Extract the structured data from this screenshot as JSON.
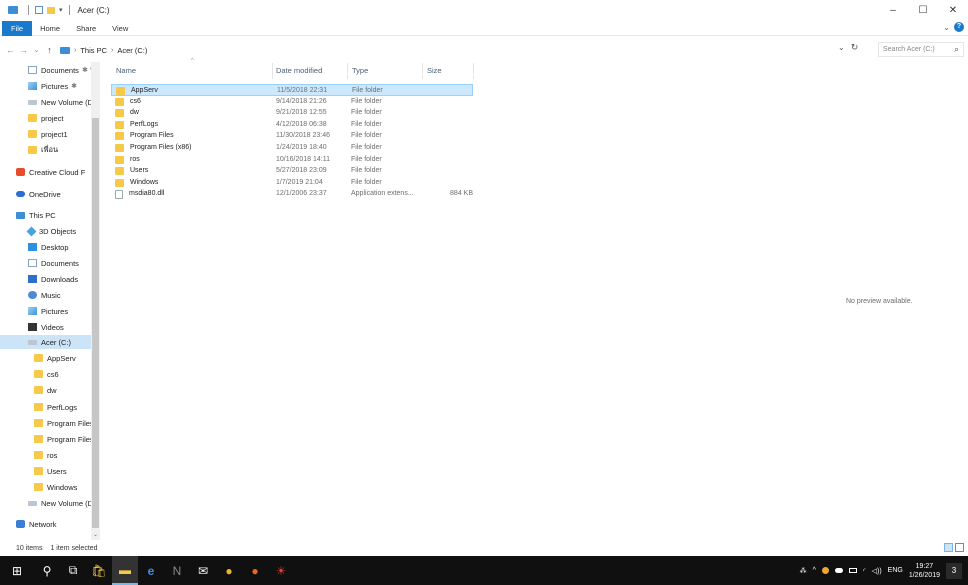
{
  "window": {
    "title": "Acer (C:)",
    "minimize": "–",
    "maximize": "☐",
    "close": "✕"
  },
  "ribbon": {
    "tabs": [
      "File",
      "Home",
      "Share",
      "View"
    ],
    "expand": "⌄",
    "help": "?"
  },
  "address": {
    "back": "←",
    "forward": "→",
    "recent": "⌄",
    "up": "↑",
    "crumbs": [
      "This PC",
      "Acer (C:)"
    ],
    "dropdown": "⌄",
    "refresh": "↻",
    "search_placeholder": "Search Acer (C:)",
    "search_icon": "⌕"
  },
  "nav": {
    "items": [
      {
        "label": "Documents",
        "icon": "doc",
        "pin": "✱ ^"
      },
      {
        "label": "Pictures",
        "icon": "pic",
        "pin": "✱"
      },
      {
        "label": "New Volume (D",
        "icon": "drive"
      },
      {
        "label": "project",
        "icon": "folder"
      },
      {
        "label": "project1",
        "icon": "folder"
      },
      {
        "label": "เพื่อน",
        "icon": "folder"
      },
      {
        "label": "Creative Cloud F",
        "icon": "cc"
      },
      {
        "label": "OneDrive",
        "icon": "cloud"
      },
      {
        "label": "This PC",
        "icon": "pc"
      },
      {
        "label": "3D Objects",
        "icon": "obj"
      },
      {
        "label": "Desktop",
        "icon": "desk"
      },
      {
        "label": "Documents",
        "icon": "doc"
      },
      {
        "label": "Downloads",
        "icon": "dl"
      },
      {
        "label": "Music",
        "icon": "music"
      },
      {
        "label": "Pictures",
        "icon": "pic"
      },
      {
        "label": "Videos",
        "icon": "video"
      },
      {
        "label": "Acer (C:)",
        "icon": "drive"
      },
      {
        "label": "AppServ",
        "icon": "folder"
      },
      {
        "label": "cs6",
        "icon": "folder"
      },
      {
        "label": "dw",
        "icon": "folder"
      },
      {
        "label": "PerfLogs",
        "icon": "folder"
      },
      {
        "label": "Program Files",
        "icon": "folder"
      },
      {
        "label": "Program Files",
        "icon": "folder"
      },
      {
        "label": "ros",
        "icon": "folder"
      },
      {
        "label": "Users",
        "icon": "folder"
      },
      {
        "label": "Windows",
        "icon": "folder"
      },
      {
        "label": "New Volume (D",
        "icon": "drive"
      },
      {
        "label": "Network",
        "icon": "net"
      }
    ],
    "scroll_down": "⌄"
  },
  "columns": {
    "name": "Name",
    "date": "Date modified",
    "type": "Type",
    "size": "Size",
    "sort_indicator": "^"
  },
  "files": [
    {
      "name": "AppServ",
      "date": "11/5/2018 22:31",
      "type": "File folder",
      "size": "",
      "kind": "folder",
      "selected": true
    },
    {
      "name": "cs6",
      "date": "9/14/2018 21:26",
      "type": "File folder",
      "size": "",
      "kind": "folder"
    },
    {
      "name": "dw",
      "date": "9/21/2018 12:55",
      "type": "File folder",
      "size": "",
      "kind": "folder"
    },
    {
      "name": "PerfLogs",
      "date": "4/12/2018 06:38",
      "type": "File folder",
      "size": "",
      "kind": "folder"
    },
    {
      "name": "Program Files",
      "date": "11/30/2018 23:46",
      "type": "File folder",
      "size": "",
      "kind": "folder"
    },
    {
      "name": "Program Files (x86)",
      "date": "1/24/2019 18:40",
      "type": "File folder",
      "size": "",
      "kind": "folder"
    },
    {
      "name": "ros",
      "date": "10/16/2018 14:11",
      "type": "File folder",
      "size": "",
      "kind": "folder"
    },
    {
      "name": "Users",
      "date": "5/27/2018 23:09",
      "type": "File folder",
      "size": "",
      "kind": "folder"
    },
    {
      "name": "Windows",
      "date": "1/7/2019 21:04",
      "type": "File folder",
      "size": "",
      "kind": "folder"
    },
    {
      "name": "msdia80.dll",
      "date": "12/1/2006 23:37",
      "type": "Application extens...",
      "size": "884 KB",
      "kind": "file"
    }
  ],
  "preview": {
    "text": "No preview available."
  },
  "status": {
    "items": "10 items",
    "selected": "1 item selected"
  },
  "taskbar": {
    "icons": [
      "windows-start-icon",
      "search-icon",
      "task-view-icon",
      "store-icon",
      "file-explorer-icon",
      "edge-icon",
      "onenote-icon",
      "mail-icon",
      "chrome-icon",
      "firefox-icon",
      "app-icon"
    ],
    "glyphs": [
      "⊞",
      "⚲",
      "⧉",
      "🛍",
      "▬",
      "e",
      "N",
      "✉",
      "●",
      "●",
      "☀"
    ],
    "tray_people": "⁂",
    "tray_chevron": "^",
    "lang": "ENG",
    "time": "19:27",
    "date": "1/26/2019",
    "notifications": "3"
  },
  "colors": {
    "accent": "#1979ca",
    "selection": "#cce8ff",
    "folder": "#f7c948",
    "taskbar": "#101010"
  }
}
